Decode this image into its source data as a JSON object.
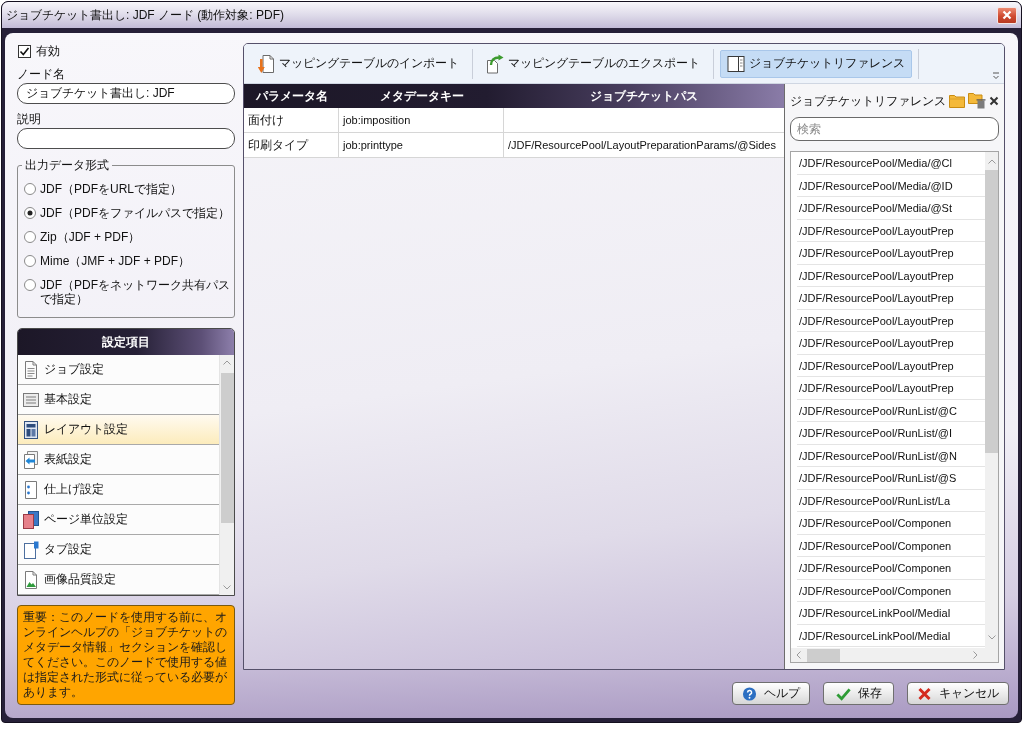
{
  "window": {
    "title": "ジョブチケット書出し: JDF ノード (動作対象: PDF)"
  },
  "enabled": {
    "label": "有効",
    "checked": true
  },
  "node_name": {
    "label": "ノード名",
    "value": "ジョブチケット書出し: JDF"
  },
  "description": {
    "label": "説明"
  },
  "output_format": {
    "legend": "出力データ形式",
    "options": [
      {
        "label": "JDF（PDFをURLで指定）",
        "selected": false
      },
      {
        "label": "JDF（PDFをファイルパスで指定）",
        "selected": true
      },
      {
        "label": "Zip（JDF + PDF）",
        "selected": false
      },
      {
        "label": "Mime（JMF + JDF + PDF）",
        "selected": false
      },
      {
        "label": "JDF（PDFをネットワーク共有パスで指定）",
        "selected": false
      }
    ]
  },
  "settings": {
    "title": "設定項目",
    "items": [
      {
        "label": "ジョブ設定",
        "kind": "job",
        "selected": false
      },
      {
        "label": "基本設定",
        "kind": "basic",
        "selected": false
      },
      {
        "label": "レイアウト設定",
        "kind": "layout",
        "selected": true
      },
      {
        "label": "表紙設定",
        "kind": "cover",
        "selected": false
      },
      {
        "label": "仕上げ設定",
        "kind": "finishing",
        "selected": false
      },
      {
        "label": "ページ単位設定",
        "kind": "page",
        "selected": false
      },
      {
        "label": "タブ設定",
        "kind": "tab",
        "selected": false
      },
      {
        "label": "画像品質設定",
        "kind": "image",
        "selected": false
      }
    ]
  },
  "note": {
    "text": "重要：このノードを使用する前に、オンラインヘルプの「ジョブチケットのメタデータ情報」セクションを確認してください。このノードで使用する値は指定された形式に従っている必要があります。"
  },
  "toolbar": {
    "buttons": [
      {
        "label": "マッピングテーブルのインポート",
        "kind": "import",
        "selected": false
      },
      {
        "label": "マッピングテーブルのエクスポート",
        "kind": "export",
        "selected": false
      },
      {
        "label": "ジョブチケットリファレンス",
        "kind": "reference",
        "selected": true
      }
    ]
  },
  "mapping_table": {
    "columns": [
      "パラメータ名",
      "メタデータキー",
      "ジョブチケットパス"
    ],
    "rows": [
      {
        "parameter": "面付け",
        "metadata_key": "job:imposition"
      },
      {
        "parameter": "印刷タイプ",
        "metadata_key": "job:printtype",
        "ticket_path": "/JDF/ResourcePool/LayoutPreparationParams/@Sides"
      }
    ]
  },
  "reference_panel": {
    "title": "ジョブチケットリファレンス",
    "search": {
      "placeholder": "検索"
    },
    "items": [
      "/JDF/ResourcePool/Media/@Cl",
      "/JDF/ResourcePool/Media/@ID",
      "/JDF/ResourcePool/Media/@St",
      "/JDF/ResourcePool/LayoutPrep",
      "/JDF/ResourcePool/LayoutPrep",
      "/JDF/ResourcePool/LayoutPrep",
      "/JDF/ResourcePool/LayoutPrep",
      "/JDF/ResourcePool/LayoutPrep",
      "/JDF/ResourcePool/LayoutPrep",
      "/JDF/ResourcePool/LayoutPrep",
      "/JDF/ResourcePool/LayoutPrep",
      "/JDF/ResourcePool/RunList/@C",
      "/JDF/ResourcePool/RunList/@I",
      "/JDF/ResourcePool/RunList/@N",
      "/JDF/ResourcePool/RunList/@S",
      "/JDF/ResourcePool/RunList/La",
      "/JDF/ResourcePool/Componen",
      "/JDF/ResourcePool/Componen",
      "/JDF/ResourcePool/Componen",
      "/JDF/ResourcePool/Componen",
      "/JDF/ResourceLinkPool/MediaI",
      "/JDF/ResourceLinkPool/MediaI"
    ]
  },
  "buttons": [
    {
      "label": "ヘルプ",
      "kind": "help"
    },
    {
      "label": "保存",
      "kind": "save"
    },
    {
      "label": "キャンセル",
      "kind": "cancel"
    }
  ]
}
